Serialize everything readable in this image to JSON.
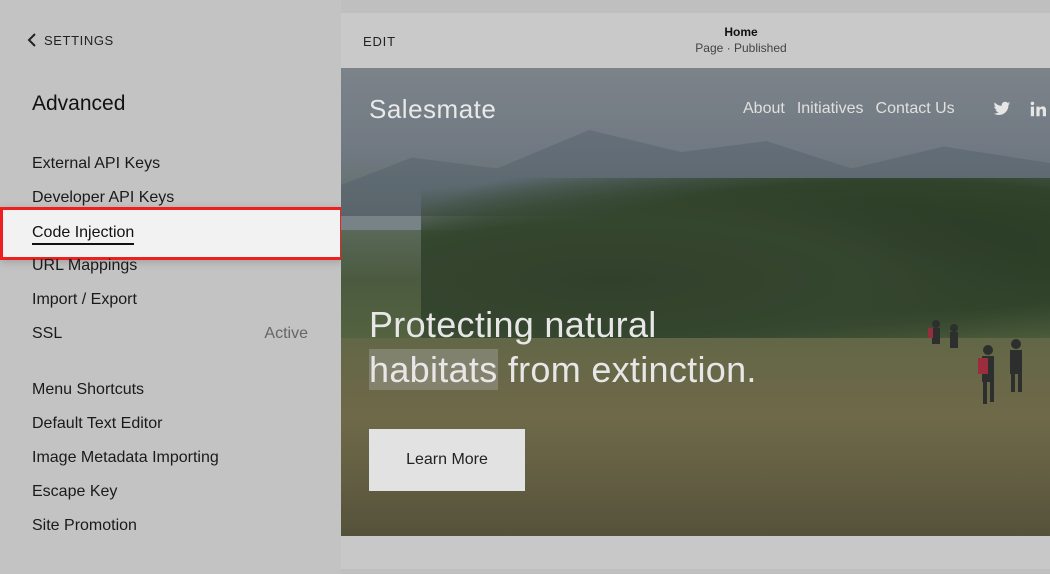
{
  "sidebar": {
    "back_label": "SETTINGS",
    "section_title": "Advanced",
    "items": [
      {
        "label": "External API Keys"
      },
      {
        "label": "Developer API Keys"
      },
      {
        "label": "Code Injection",
        "highlighted": true
      },
      {
        "label": "URL Mappings"
      },
      {
        "label": "Import / Export"
      },
      {
        "label": "SSL",
        "status": "Active"
      },
      {
        "label": "Menu Shortcuts"
      },
      {
        "label": "Default Text Editor"
      },
      {
        "label": "Image Metadata Importing"
      },
      {
        "label": "Escape Key"
      },
      {
        "label": "Site Promotion"
      }
    ]
  },
  "topbar": {
    "edit_label": "EDIT",
    "page_title": "Home",
    "page_status": "Page · Published"
  },
  "site": {
    "brand": "Salesmate",
    "nav": [
      "About",
      "Initiatives",
      "Contact Us"
    ],
    "social_icons": [
      "twitter-icon",
      "linkedin-icon"
    ],
    "heading_highlight": "habitats",
    "heading_part1": "Protecting natural",
    "heading_part2": "from extinction.",
    "cta_label": "Learn More"
  },
  "colors": {
    "highlight_border": "#ee1f1f",
    "sidebar_bg": "#c3c3c3"
  }
}
